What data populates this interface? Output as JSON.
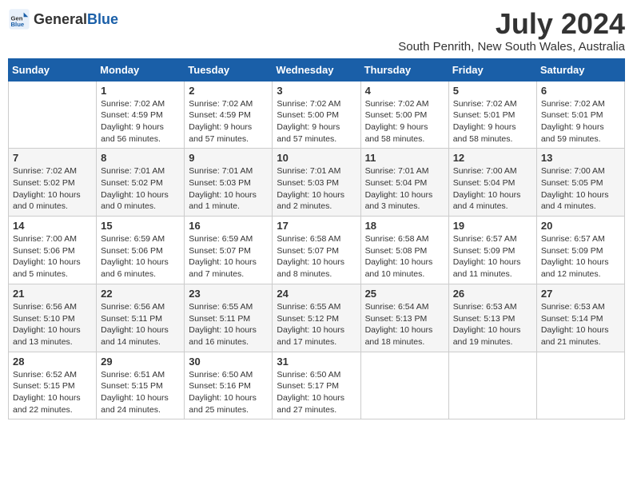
{
  "logo": {
    "general": "General",
    "blue": "Blue"
  },
  "title": {
    "month_year": "July 2024",
    "location": "South Penrith, New South Wales, Australia"
  },
  "weekdays": [
    "Sunday",
    "Monday",
    "Tuesday",
    "Wednesday",
    "Thursday",
    "Friday",
    "Saturday"
  ],
  "weeks": [
    [
      {
        "day": "",
        "sunrise": "",
        "sunset": "",
        "daylight": ""
      },
      {
        "day": "1",
        "sunrise": "7:02 AM",
        "sunset": "4:59 PM",
        "daylight": "9 hours and 56 minutes."
      },
      {
        "day": "2",
        "sunrise": "7:02 AM",
        "sunset": "4:59 PM",
        "daylight": "9 hours and 57 minutes."
      },
      {
        "day": "3",
        "sunrise": "7:02 AM",
        "sunset": "5:00 PM",
        "daylight": "9 hours and 57 minutes."
      },
      {
        "day": "4",
        "sunrise": "7:02 AM",
        "sunset": "5:00 PM",
        "daylight": "9 hours and 58 minutes."
      },
      {
        "day": "5",
        "sunrise": "7:02 AM",
        "sunset": "5:01 PM",
        "daylight": "9 hours and 58 minutes."
      },
      {
        "day": "6",
        "sunrise": "7:02 AM",
        "sunset": "5:01 PM",
        "daylight": "9 hours and 59 minutes."
      }
    ],
    [
      {
        "day": "7",
        "sunrise": "7:02 AM",
        "sunset": "5:02 PM",
        "daylight": "10 hours and 0 minutes."
      },
      {
        "day": "8",
        "sunrise": "7:01 AM",
        "sunset": "5:02 PM",
        "daylight": "10 hours and 0 minutes."
      },
      {
        "day": "9",
        "sunrise": "7:01 AM",
        "sunset": "5:03 PM",
        "daylight": "10 hours and 1 minute."
      },
      {
        "day": "10",
        "sunrise": "7:01 AM",
        "sunset": "5:03 PM",
        "daylight": "10 hours and 2 minutes."
      },
      {
        "day": "11",
        "sunrise": "7:01 AM",
        "sunset": "5:04 PM",
        "daylight": "10 hours and 3 minutes."
      },
      {
        "day": "12",
        "sunrise": "7:00 AM",
        "sunset": "5:04 PM",
        "daylight": "10 hours and 4 minutes."
      },
      {
        "day": "13",
        "sunrise": "7:00 AM",
        "sunset": "5:05 PM",
        "daylight": "10 hours and 4 minutes."
      }
    ],
    [
      {
        "day": "14",
        "sunrise": "7:00 AM",
        "sunset": "5:06 PM",
        "daylight": "10 hours and 5 minutes."
      },
      {
        "day": "15",
        "sunrise": "6:59 AM",
        "sunset": "5:06 PM",
        "daylight": "10 hours and 6 minutes."
      },
      {
        "day": "16",
        "sunrise": "6:59 AM",
        "sunset": "5:07 PM",
        "daylight": "10 hours and 7 minutes."
      },
      {
        "day": "17",
        "sunrise": "6:58 AM",
        "sunset": "5:07 PM",
        "daylight": "10 hours and 8 minutes."
      },
      {
        "day": "18",
        "sunrise": "6:58 AM",
        "sunset": "5:08 PM",
        "daylight": "10 hours and 10 minutes."
      },
      {
        "day": "19",
        "sunrise": "6:57 AM",
        "sunset": "5:09 PM",
        "daylight": "10 hours and 11 minutes."
      },
      {
        "day": "20",
        "sunrise": "6:57 AM",
        "sunset": "5:09 PM",
        "daylight": "10 hours and 12 minutes."
      }
    ],
    [
      {
        "day": "21",
        "sunrise": "6:56 AM",
        "sunset": "5:10 PM",
        "daylight": "10 hours and 13 minutes."
      },
      {
        "day": "22",
        "sunrise": "6:56 AM",
        "sunset": "5:11 PM",
        "daylight": "10 hours and 14 minutes."
      },
      {
        "day": "23",
        "sunrise": "6:55 AM",
        "sunset": "5:11 PM",
        "daylight": "10 hours and 16 minutes."
      },
      {
        "day": "24",
        "sunrise": "6:55 AM",
        "sunset": "5:12 PM",
        "daylight": "10 hours and 17 minutes."
      },
      {
        "day": "25",
        "sunrise": "6:54 AM",
        "sunset": "5:13 PM",
        "daylight": "10 hours and 18 minutes."
      },
      {
        "day": "26",
        "sunrise": "6:53 AM",
        "sunset": "5:13 PM",
        "daylight": "10 hours and 19 minutes."
      },
      {
        "day": "27",
        "sunrise": "6:53 AM",
        "sunset": "5:14 PM",
        "daylight": "10 hours and 21 minutes."
      }
    ],
    [
      {
        "day": "28",
        "sunrise": "6:52 AM",
        "sunset": "5:15 PM",
        "daylight": "10 hours and 22 minutes."
      },
      {
        "day": "29",
        "sunrise": "6:51 AM",
        "sunset": "5:15 PM",
        "daylight": "10 hours and 24 minutes."
      },
      {
        "day": "30",
        "sunrise": "6:50 AM",
        "sunset": "5:16 PM",
        "daylight": "10 hours and 25 minutes."
      },
      {
        "day": "31",
        "sunrise": "6:50 AM",
        "sunset": "5:17 PM",
        "daylight": "10 hours and 27 minutes."
      },
      {
        "day": "",
        "sunrise": "",
        "sunset": "",
        "daylight": ""
      },
      {
        "day": "",
        "sunrise": "",
        "sunset": "",
        "daylight": ""
      },
      {
        "day": "",
        "sunrise": "",
        "sunset": "",
        "daylight": ""
      }
    ]
  ],
  "labels": {
    "sunrise": "Sunrise:",
    "sunset": "Sunset:",
    "daylight": "Daylight:"
  }
}
